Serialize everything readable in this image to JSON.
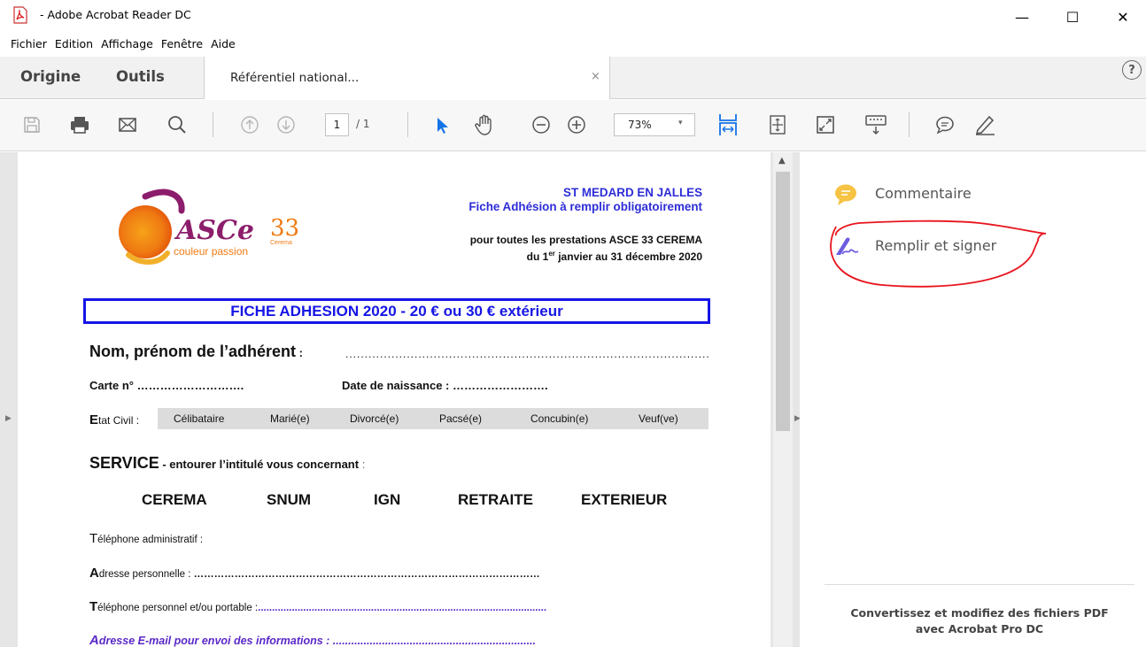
{
  "window": {
    "title": " - Adobe Acrobat Reader DC",
    "controls": {
      "minimize": "—",
      "maximize": "☐",
      "close": "✕"
    }
  },
  "menu": [
    "Fichier",
    "Edition",
    "Affichage",
    "Fenêtre",
    "Aide"
  ],
  "tabs": {
    "home": "Origine",
    "tools": "Outils",
    "document": "Référentiel national...",
    "close": "×",
    "help": "?"
  },
  "toolbar": {
    "page_current": "1",
    "page_total": "/ 1",
    "zoom": "73%",
    "zoom_caret": "▾"
  },
  "document": {
    "logo": {
      "brand": "ASCe",
      "number": "33",
      "sub": "Cerema",
      "tagline": "couleur passion"
    },
    "header_city": "ST MEDARD EN JALLES",
    "header_subtitle": "Fiche Adhésion à remplir obligatoirement",
    "header_line3": "pour toutes les prestations ASCE 33 CEREMA",
    "header_line4_a": "du 1",
    "header_line4_sup": "er",
    "header_line4_b": " janvier au 31 décembre 2020",
    "fiche_title": "FICHE ADHESION 2020  -   20 €    ou    30 € extérieur",
    "nom_label": "Nom, prénom de l’adhérent",
    "nom_colon": " : ",
    "nom_dots": "...............................................................................................",
    "carte_label": "Carte n° ……………………….",
    "date_label": "Date de naissance : …………………….",
    "etat_first": "E",
    "etat_rest": "tat Civil : ",
    "civil_options": [
      "Célibataire",
      "Marié(e)",
      "Divorcé(e)",
      "Pacsé(e)",
      "Concubin(e)",
      "Veuf(ve)"
    ],
    "service_label": "SERVICE",
    "service_sub": " - entourer l’intitulé vous concernant",
    "service_colon": "  :",
    "services": [
      "CEREMA",
      "SNUM",
      "IGN",
      "RETRAITE",
      "EXTERIEUR"
    ],
    "tel_admin_first": "T",
    "tel_admin_rest": "éléphone administratif :",
    "adresse_first": "A",
    "adresse_rest": "dresse personnelle : ",
    "adresse_dots": "…………………………………………………………………………………………",
    "tel_perso_first": "T",
    "tel_perso_rest": "éléphone personnel et/ou portable :",
    "tel_perso_dots": "......................................................................................................",
    "email_first": "A",
    "email_rest": "dresse E-mail pour envoi des informations : .................................................................."
  },
  "right_pane": {
    "comment": "Commentaire",
    "fill_sign": "Remplir et signer",
    "promo_line1": "Convertissez et modifiez des fichiers PDF",
    "promo_line2": "avec Acrobat Pro DC"
  },
  "colors": {
    "accent_blue": "#1473e6",
    "doc_blue": "#1515e6",
    "doc_purple": "#5a28c8",
    "annotation_red": "#e8141c",
    "comment_yellow": "#f6c342",
    "fill_sign_purple": "#6b5ce0"
  }
}
